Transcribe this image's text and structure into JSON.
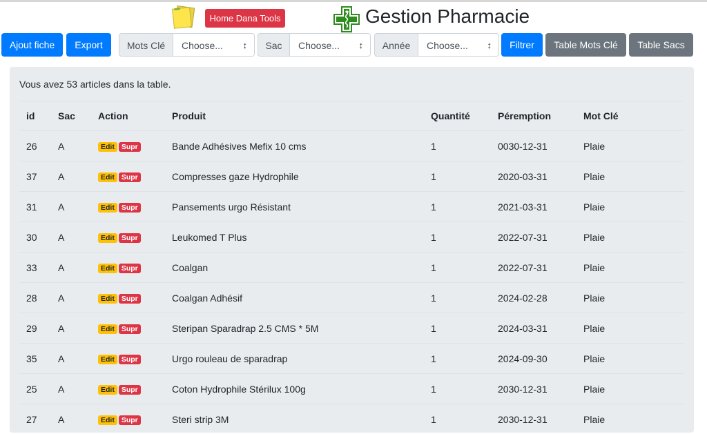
{
  "header": {
    "home_button": "Home Dana Tools",
    "title": "Gestion Pharmacie"
  },
  "toolbar": {
    "ajout_fiche": "Ajout fiche",
    "export": "Export",
    "mots_cle_label": "Mots Clé",
    "mots_cle_value": "Choose...",
    "sac_label": "Sac",
    "sac_value": "Choose...",
    "annee_label": "Année",
    "annee_value": "Choose...",
    "filtrer": "Filtrer",
    "table_mots_cle": "Table Mots Clé",
    "table_sacs": "Table Sacs"
  },
  "main": {
    "count_text": "Vous avez 53 articles dans la table.",
    "columns": [
      "id",
      "Sac",
      "Action",
      "Produit",
      "Quantité",
      "Péremption",
      "Mot Clé"
    ],
    "edit_label": "Edit",
    "supr_label": "Supr",
    "rows": [
      {
        "id": "26",
        "sac": "A",
        "produit": "Bande Adhésives Mefix 10 cms",
        "quantite": "1",
        "peremption": "0030-12-31",
        "mot_cle": "Plaie"
      },
      {
        "id": "37",
        "sac": "A",
        "produit": "Compresses gaze Hydrophile",
        "quantite": "1",
        "peremption": "2020-03-31",
        "mot_cle": "Plaie"
      },
      {
        "id": "31",
        "sac": "A",
        "produit": "Pansements urgo Résistant",
        "quantite": "1",
        "peremption": "2021-03-31",
        "mot_cle": "Plaie"
      },
      {
        "id": "30",
        "sac": "A",
        "produit": "Leukomed T Plus",
        "quantite": "1",
        "peremption": "2022-07-31",
        "mot_cle": "Plaie"
      },
      {
        "id": "33",
        "sac": "A",
        "produit": "Coalgan",
        "quantite": "1",
        "peremption": "2022-07-31",
        "mot_cle": "Plaie"
      },
      {
        "id": "28",
        "sac": "A",
        "produit": "Coalgan Adhésif",
        "quantite": "1",
        "peremption": "2024-02-28",
        "mot_cle": "Plaie"
      },
      {
        "id": "29",
        "sac": "A",
        "produit": "Steripan Sparadrap 2.5 CMS * 5M",
        "quantite": "1",
        "peremption": "2024-03-31",
        "mot_cle": "Plaie"
      },
      {
        "id": "35",
        "sac": "A",
        "produit": "Urgo rouleau de sparadrap",
        "quantite": "1",
        "peremption": "2024-09-30",
        "mot_cle": "Plaie"
      },
      {
        "id": "25",
        "sac": "A",
        "produit": "Coton Hydrophile Stérilux 100g",
        "quantite": "1",
        "peremption": "2030-12-31",
        "mot_cle": "Plaie"
      },
      {
        "id": "27",
        "sac": "A",
        "produit": "Steri strip 3M",
        "quantite": "1",
        "peremption": "2030-12-31",
        "mot_cle": "Plaie"
      }
    ]
  },
  "colors": {
    "primary": "#007bff",
    "secondary": "#6c757d",
    "danger": "#dc3545",
    "warning": "#ffc107",
    "card_bg": "#e9ecef",
    "pharmacy_green": "#2e8b1e"
  },
  "icons": {
    "notes": "sticky-notes-icon",
    "pharmacy": "pharmacy-cross-icon",
    "select_caret": "select-caret-icon"
  }
}
